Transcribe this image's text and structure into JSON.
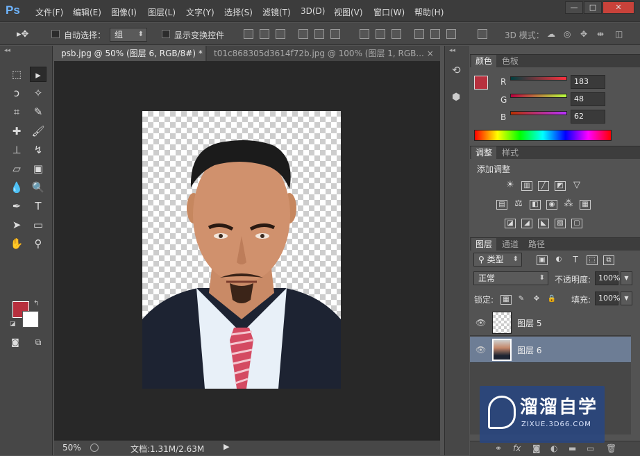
{
  "app": {
    "logo": "Ps"
  },
  "menu": [
    "文件(F)",
    "编辑(E)",
    "图像(I)",
    "图层(L)",
    "文字(Y)",
    "选择(S)",
    "滤镜(T)",
    "3D(D)",
    "视图(V)",
    "窗口(W)",
    "帮助(H)"
  ],
  "window_controls": {
    "minimize": "—",
    "maximize": "□",
    "close": "✕"
  },
  "options": {
    "auto_select_label": "自动选择：",
    "auto_select_value": "组",
    "show_transform_label": "显示变换控件",
    "mode3d_label": "3D 模式："
  },
  "tabs": [
    {
      "label": "psb.jpg @ 50% (图层 6, RGB/8#) *",
      "close": "×"
    },
    {
      "label": "t01c868305d3614f72b.jpg @ 100% (图层 1, RGB...",
      "close": "×"
    }
  ],
  "status": {
    "zoom": "50%",
    "doc": "文档:1.31M/2.63M",
    "arrow": "▶"
  },
  "color_panel": {
    "tabs": [
      "颜色",
      "色板"
    ],
    "r_label": "R",
    "g_label": "G",
    "b_label": "B",
    "r": "183",
    "g": "48",
    "b": "62",
    "fg_color": "#b7303e"
  },
  "adjust_panel": {
    "tabs": [
      "调整",
      "样式"
    ],
    "title": "添加调整"
  },
  "layers_panel": {
    "tabs": [
      "图层",
      "通道",
      "路径"
    ],
    "filter_kind": "类型",
    "blend_mode": "正常",
    "opacity_label": "不透明度:",
    "opacity": "100%",
    "lock_label": "锁定:",
    "fill_label": "填充:",
    "fill": "100%",
    "layers": [
      {
        "name": "图层 5"
      },
      {
        "name": "图层 6"
      }
    ]
  },
  "watermark": {
    "title": "溜溜自学",
    "url": "ZIXUE.3D66.COM"
  }
}
